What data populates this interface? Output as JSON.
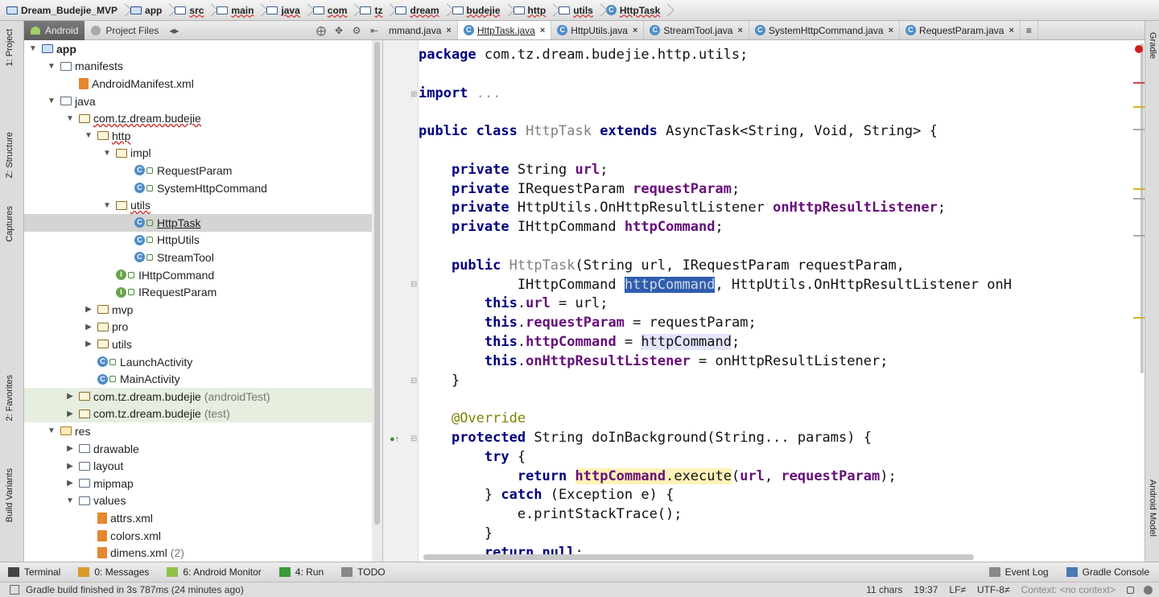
{
  "breadcrumb": [
    "Dream_Budejie_MVP",
    "app",
    "src",
    "main",
    "java",
    "com",
    "tz",
    "dream",
    "budejie",
    "http",
    "utils",
    "HttpTask"
  ],
  "project_toolbar": {
    "tab_android": "Android",
    "tab_project_files": "Project Files"
  },
  "left_strip": {
    "project": "1: Project",
    "structure": "Z: Structure",
    "captures": "Captures",
    "favorites": "2: Favorites",
    "build_variants": "Build Variants"
  },
  "right_strip": {
    "gradle": "Gradle",
    "android_model": "Android Model"
  },
  "editor_tabs": [
    {
      "label": "mmand.java",
      "active": false
    },
    {
      "label": "HttpTask.java",
      "active": true
    },
    {
      "label": "HttpUtils.java",
      "active": false
    },
    {
      "label": "StreamTool.java",
      "active": false
    },
    {
      "label": "SystemHttpCommand.java",
      "active": false
    },
    {
      "label": "RequestParam.java",
      "active": false
    }
  ],
  "editor_tabs_overflow": "≡",
  "tree": [
    {
      "label": "app",
      "depth": 0,
      "icon": "app-folder",
      "expanded": true
    },
    {
      "label": "manifests",
      "depth": 1,
      "icon": "folder",
      "expanded": true
    },
    {
      "label": "AndroidManifest.xml",
      "depth": 2,
      "icon": "xml"
    },
    {
      "label": "java",
      "depth": 1,
      "icon": "folder",
      "expanded": true
    },
    {
      "label": "com.tz.dream.budejie",
      "depth": 2,
      "icon": "package",
      "expanded": true,
      "underline": true
    },
    {
      "label": "http",
      "depth": 3,
      "icon": "package",
      "expanded": true,
      "underline": true
    },
    {
      "label": "impl",
      "depth": 4,
      "icon": "package",
      "expanded": true
    },
    {
      "label": "RequestParam",
      "depth": 5,
      "icon": "class"
    },
    {
      "label": "SystemHttpCommand",
      "depth": 5,
      "icon": "class"
    },
    {
      "label": "utils",
      "depth": 4,
      "icon": "package",
      "expanded": true,
      "underline": true
    },
    {
      "label": "HttpTask",
      "depth": 5,
      "icon": "class",
      "selected": true,
      "underline": true
    },
    {
      "label": "HttpUtils",
      "depth": 5,
      "icon": "class"
    },
    {
      "label": "StreamTool",
      "depth": 5,
      "icon": "class"
    },
    {
      "label": "IHttpCommand",
      "depth": 4,
      "icon": "interface"
    },
    {
      "label": "IRequestParam",
      "depth": 4,
      "icon": "interface"
    },
    {
      "label": "mvp",
      "depth": 3,
      "icon": "package",
      "expanded": false
    },
    {
      "label": "pro",
      "depth": 3,
      "icon": "package",
      "expanded": false
    },
    {
      "label": "utils",
      "depth": 3,
      "icon": "package",
      "expanded": false
    },
    {
      "label": "LaunchActivity",
      "depth": 3,
      "icon": "class"
    },
    {
      "label": "MainActivity",
      "depth": 3,
      "icon": "class"
    },
    {
      "label": "com.tz.dream.budejie",
      "suffix": "(androidTest)",
      "depth": 2,
      "icon": "package",
      "expanded": false,
      "test": true
    },
    {
      "label": "com.tz.dream.budejie",
      "suffix": "(test)",
      "depth": 2,
      "icon": "package",
      "expanded": false,
      "test": true
    },
    {
      "label": "res",
      "depth": 1,
      "icon": "res-folder",
      "expanded": true
    },
    {
      "label": "drawable",
      "depth": 2,
      "icon": "folder",
      "expanded": false
    },
    {
      "label": "layout",
      "depth": 2,
      "icon": "folder",
      "expanded": false
    },
    {
      "label": "mipmap",
      "depth": 2,
      "icon": "folder",
      "expanded": false
    },
    {
      "label": "values",
      "depth": 2,
      "icon": "folder",
      "expanded": true
    },
    {
      "label": "attrs.xml",
      "depth": 3,
      "icon": "xml"
    },
    {
      "label": "colors.xml",
      "depth": 3,
      "icon": "xml"
    },
    {
      "label": "dimens.xml",
      "suffix": "(2)",
      "depth": 3,
      "icon": "xml",
      "expanded": false
    }
  ],
  "code": [
    [
      [
        "kw",
        "package"
      ],
      [
        "t",
        " com.tz.dream.budejie.http.utils;"
      ]
    ],
    [],
    [
      [
        "kw",
        "import"
      ],
      [
        "dim",
        " ..."
      ]
    ],
    [],
    [
      [
        "kw",
        "public class"
      ],
      [
        "t",
        " "
      ],
      [
        "gray",
        "HttpTask"
      ],
      [
        "t",
        " "
      ],
      [
        "kw",
        "extends"
      ],
      [
        "t",
        " AsyncTask<String, Void, String> {"
      ]
    ],
    [],
    [
      [
        "t",
        "    "
      ],
      [
        "kw",
        "private"
      ],
      [
        "t",
        " String "
      ],
      [
        "fld",
        "url"
      ],
      [
        "t",
        ";"
      ]
    ],
    [
      [
        "t",
        "    "
      ],
      [
        "kw",
        "private"
      ],
      [
        "t",
        " IRequestParam "
      ],
      [
        "fld",
        "requestParam"
      ],
      [
        "t",
        ";"
      ]
    ],
    [
      [
        "t",
        "    "
      ],
      [
        "kw",
        "private"
      ],
      [
        "t",
        " HttpUtils.OnHttpResultListener "
      ],
      [
        "fld",
        "onHttpResultListener"
      ],
      [
        "t",
        ";"
      ]
    ],
    [
      [
        "t",
        "    "
      ],
      [
        "kw",
        "private"
      ],
      [
        "t",
        " IHttpCommand "
      ],
      [
        "fld",
        "httpCommand"
      ],
      [
        "t",
        ";"
      ]
    ],
    [],
    [
      [
        "t",
        "    "
      ],
      [
        "kw",
        "public"
      ],
      [
        "t",
        " "
      ],
      [
        "gray",
        "HttpTask"
      ],
      [
        "t",
        "(String url, IRequestParam requestParam,"
      ]
    ],
    [
      [
        "t",
        "            IHttpCommand "
      ],
      [
        "sel",
        "httpCommand"
      ],
      [
        "t",
        ", HttpUtils.OnHttpResultListener onH"
      ]
    ],
    [
      [
        "t",
        "        "
      ],
      [
        "kw",
        "this"
      ],
      [
        "t",
        "."
      ],
      [
        "fld",
        "url"
      ],
      [
        "t",
        " = url;"
      ]
    ],
    [
      [
        "t",
        "        "
      ],
      [
        "kw",
        "this"
      ],
      [
        "t",
        "."
      ],
      [
        "fld",
        "requestParam"
      ],
      [
        "t",
        " = requestParam;"
      ]
    ],
    [
      [
        "t",
        "        "
      ],
      [
        "kw",
        "this"
      ],
      [
        "t",
        "."
      ],
      [
        "fld",
        "httpCommand"
      ],
      [
        "t",
        " = "
      ],
      [
        "use",
        "httpCommand"
      ],
      [
        "t",
        ";"
      ]
    ],
    [
      [
        "t",
        "        "
      ],
      [
        "kw",
        "this"
      ],
      [
        "t",
        "."
      ],
      [
        "fld",
        "onHttpResultListener"
      ],
      [
        "t",
        " = onHttpResultListener;"
      ]
    ],
    [
      [
        "t",
        "    }"
      ]
    ],
    [],
    [
      [
        "t",
        "    "
      ],
      [
        "ann",
        "@Override"
      ]
    ],
    [
      [
        "t",
        "    "
      ],
      [
        "kw",
        "protected"
      ],
      [
        "t",
        " String doInBackground(String... params) {"
      ]
    ],
    [
      [
        "t",
        "        "
      ],
      [
        "kw",
        "try"
      ],
      [
        "t",
        " {"
      ]
    ],
    [
      [
        "t",
        "            "
      ],
      [
        "kw",
        "return"
      ],
      [
        "t",
        " "
      ],
      [
        "callf",
        "httpCommand"
      ],
      [
        "call",
        ".execute"
      ],
      [
        "t",
        "("
      ],
      [
        "fld",
        "url"
      ],
      [
        "t",
        ", "
      ],
      [
        "fld",
        "requestParam"
      ],
      [
        "t",
        ");"
      ]
    ],
    [
      [
        "t",
        "        } "
      ],
      [
        "kw",
        "catch"
      ],
      [
        "t",
        " (Exception e) {"
      ]
    ],
    [
      [
        "t",
        "            e.printStackTrace();"
      ]
    ],
    [
      [
        "t",
        "        }"
      ]
    ],
    [
      [
        "t",
        "        "
      ],
      [
        "kw",
        "return null"
      ],
      [
        "t",
        ";"
      ]
    ]
  ],
  "toolwindows": [
    {
      "label": "Terminal",
      "icon": "terminal-icon"
    },
    {
      "label": "0: Messages",
      "icon": "messages-icon"
    },
    {
      "label": "6: Android Monitor",
      "icon": "android-icon"
    },
    {
      "label": "4: Run",
      "icon": "run-icon"
    },
    {
      "label": "TODO",
      "icon": "todo-icon"
    }
  ],
  "toolwindows_right": [
    {
      "label": "Event Log",
      "icon": "event-log-icon"
    },
    {
      "label": "Gradle Console",
      "icon": "gradle-console-icon"
    }
  ],
  "status": {
    "message": "Gradle build finished in 3s 787ms (24 minutes ago)",
    "chars": "11 chars",
    "position": "19:37",
    "line_sep": "LF≠",
    "encoding": "UTF-8≠",
    "context": "Context: <no context>"
  },
  "colors": {
    "keyword": "#000080",
    "field": "#660e7a",
    "selection": "#2f5eb0",
    "annotation": "#808000"
  }
}
